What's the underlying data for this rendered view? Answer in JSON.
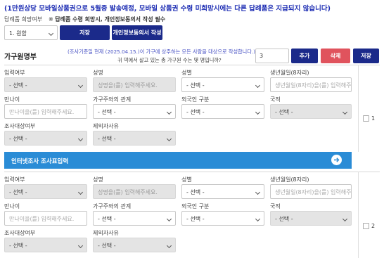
{
  "notice": "(1만원상당 모바일상품권으로 5월중 발송예정, 모바일 상품권 수령 미희망시에는 다른 답례품은 지급되지 않습니다)",
  "gift": {
    "label": "답례품 희망여부",
    "note_mark": "※",
    "note_text": "답례품 수령 희망시, 개인정보동의서 작성 필수",
    "selected": "1. 원함",
    "save_label": "저장",
    "consent_label": "개인정보동의서 작성"
  },
  "household": {
    "title": "가구원명부",
    "info_line1": "(조사기준일 현재 (2025.04.15.)이 가구에 상주하는 모든 사람을 대상으로 작성합니다.)",
    "info_line2": "귀 댁에서 살고 있는 총 가구원 수는 몇 명입니까?",
    "count_value": "3",
    "add_label": "추가",
    "delete_label": "삭제",
    "save_label": "저장"
  },
  "labels": {
    "input_status": "입력여부",
    "name": "성명",
    "gender": "성별",
    "birth": "생년월일(8자리)",
    "age": "만나이",
    "relation": "가구주와의 관계",
    "foreigner": "외국인 구분",
    "nationality": "국적",
    "target": "조사대상여부",
    "exclusion": "제외자사유"
  },
  "placeholders": {
    "select": "- 선택 -",
    "name": "성명을(를) 입력해주세요.",
    "birth": "생년월일(8자리)을(를) 입력해주세요.",
    "age": "만나이을(를) 입력해주세요."
  },
  "members": [
    {
      "number": "1"
    },
    {
      "number": "2"
    }
  ],
  "banner": {
    "label": "인터넷조사 조사표입력",
    "icon": "arrow-right-icon"
  },
  "colors": {
    "notice": "#1f2fb4",
    "button_primary": "#1b2a8a",
    "button_danger": "#e0535d",
    "banner": "#2a8cd6"
  }
}
